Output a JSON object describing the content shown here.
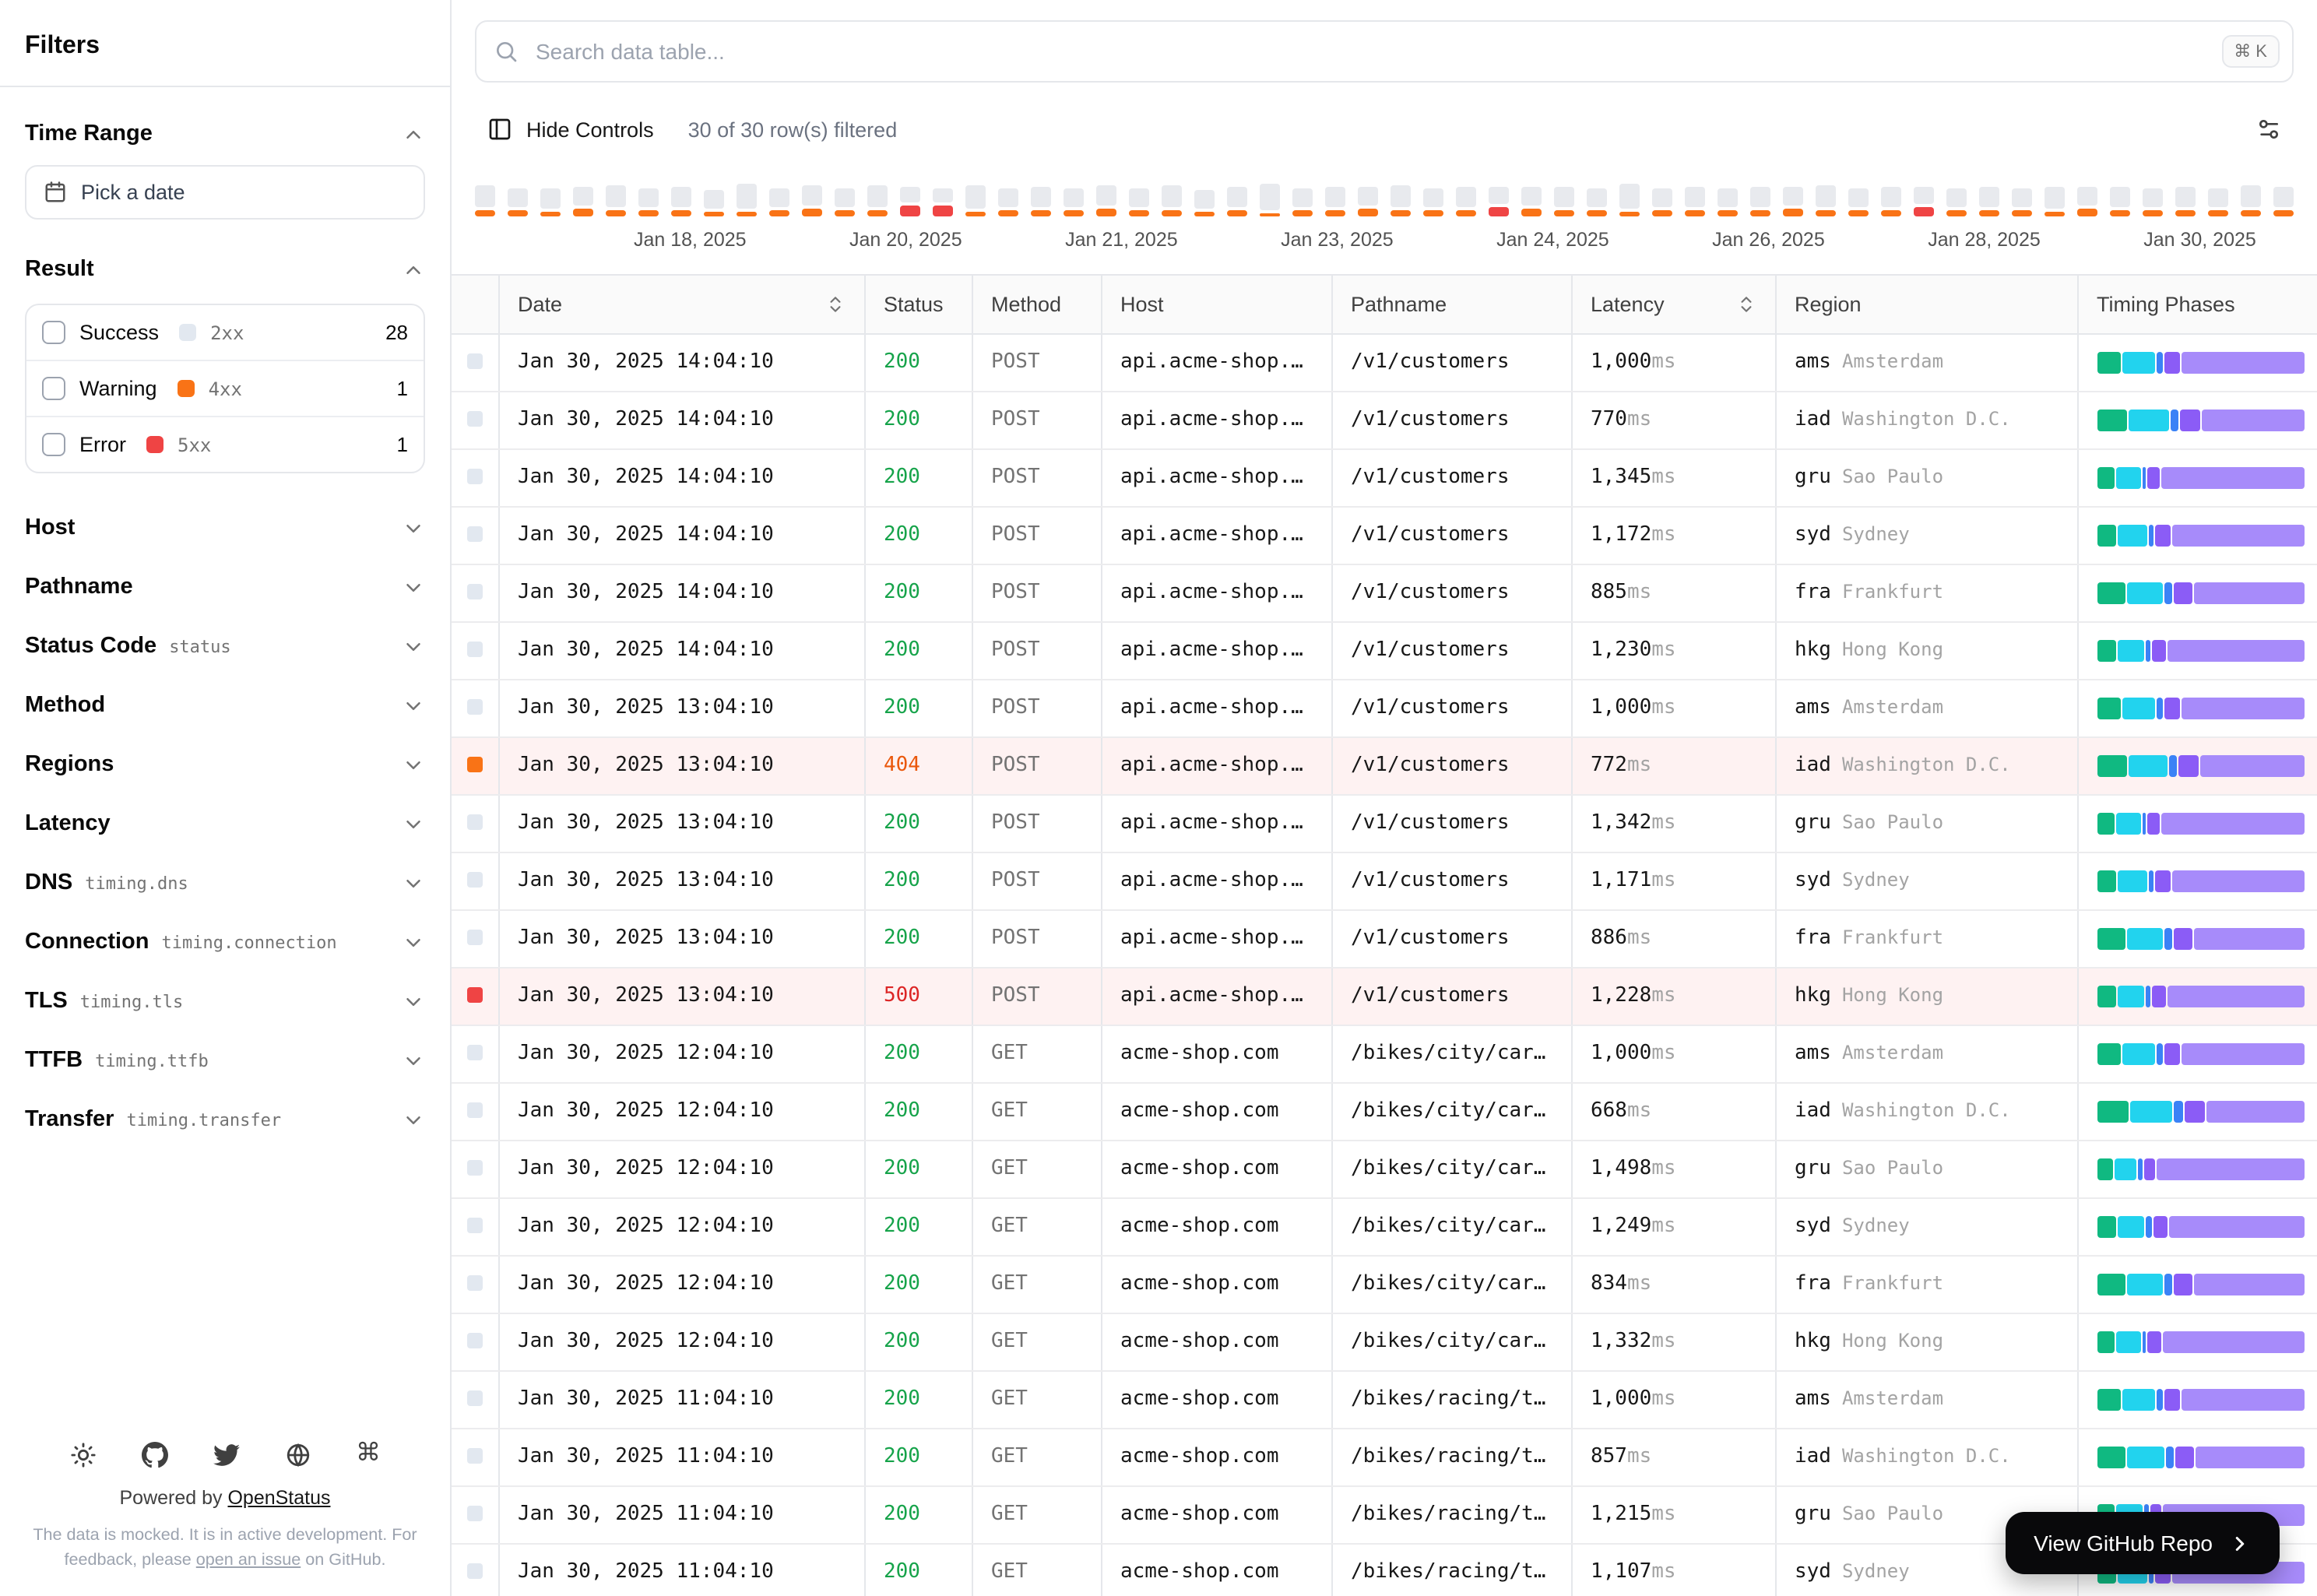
{
  "sidebar": {
    "title": "Filters",
    "time_range": {
      "label": "Time Range",
      "picker": "Pick a date"
    },
    "result": {
      "label": "Result",
      "options": [
        {
          "label": "Success",
          "code": "2xx",
          "count": "28",
          "color": "#e2e8f0"
        },
        {
          "label": "Warning",
          "code": "4xx",
          "count": "1",
          "color": "#f97316"
        },
        {
          "label": "Error",
          "code": "5xx",
          "count": "1",
          "color": "#ef4444"
        }
      ]
    },
    "sections": [
      {
        "label": "Host",
        "tag": ""
      },
      {
        "label": "Pathname",
        "tag": ""
      },
      {
        "label": "Status Code",
        "tag": "status"
      },
      {
        "label": "Method",
        "tag": ""
      },
      {
        "label": "Regions",
        "tag": ""
      },
      {
        "label": "Latency",
        "tag": ""
      },
      {
        "label": "DNS",
        "tag": "timing.dns"
      },
      {
        "label": "Connection",
        "tag": "timing.connection"
      },
      {
        "label": "TLS",
        "tag": "timing.tls"
      },
      {
        "label": "TTFB",
        "tag": "timing.ttfb"
      },
      {
        "label": "Transfer",
        "tag": "timing.transfer"
      }
    ],
    "footer": {
      "powered_prefix": "Powered by ",
      "brand": "OpenStatus",
      "note_prefix": "The data is mocked. It is in active development. For feedback, please ",
      "note_link": "open an issue",
      "note_suffix": " on GitHub."
    }
  },
  "toolbar": {
    "search_placeholder": "Search data table...",
    "kbd": "⌘ K",
    "hide_controls": "Hide Controls",
    "filter_status": "30 of 30 row(s) filtered"
  },
  "timeline": {
    "labels": [
      "Jan 18, 2025",
      "Jan 20, 2025",
      "Jan 21, 2025",
      "Jan 23, 2025",
      "Jan 24, 2025",
      "Jan 26, 2025",
      "Jan 28, 2025",
      "Jan 30, 2025"
    ],
    "bars": [
      [
        14,
        4,
        0
      ],
      [
        12,
        4,
        0
      ],
      [
        13,
        3,
        0
      ],
      [
        12,
        5,
        0
      ],
      [
        14,
        4,
        0
      ],
      [
        12,
        4,
        0
      ],
      [
        13,
        4,
        0
      ],
      [
        12,
        3,
        0
      ],
      [
        16,
        3,
        0
      ],
      [
        12,
        4,
        0
      ],
      [
        13,
        5,
        0
      ],
      [
        12,
        4,
        0
      ],
      [
        14,
        4,
        0
      ],
      [
        10,
        7,
        1
      ],
      [
        9,
        7,
        1
      ],
      [
        15,
        3,
        0
      ],
      [
        12,
        4,
        0
      ],
      [
        13,
        4,
        0
      ],
      [
        12,
        4,
        0
      ],
      [
        13,
        5,
        0
      ],
      [
        12,
        4,
        0
      ],
      [
        14,
        4,
        0
      ],
      [
        12,
        3,
        0
      ],
      [
        13,
        4,
        0
      ],
      [
        17,
        2,
        0
      ],
      [
        12,
        4,
        0
      ],
      [
        13,
        4,
        0
      ],
      [
        12,
        5,
        0
      ],
      [
        14,
        4,
        0
      ],
      [
        12,
        4,
        0
      ],
      [
        13,
        4,
        0
      ],
      [
        11,
        6,
        1
      ],
      [
        12,
        5,
        0
      ],
      [
        13,
        4,
        0
      ],
      [
        12,
        4,
        0
      ],
      [
        16,
        3,
        0
      ],
      [
        12,
        4,
        0
      ],
      [
        13,
        4,
        0
      ],
      [
        12,
        4,
        0
      ],
      [
        13,
        4,
        0
      ],
      [
        12,
        5,
        0
      ],
      [
        14,
        4,
        0
      ],
      [
        12,
        4,
        0
      ],
      [
        13,
        4,
        0
      ],
      [
        11,
        6,
        1
      ],
      [
        12,
        4,
        0
      ],
      [
        13,
        4,
        0
      ],
      [
        12,
        4,
        0
      ],
      [
        14,
        3,
        0
      ],
      [
        12,
        5,
        0
      ],
      [
        13,
        4,
        0
      ],
      [
        12,
        4,
        0
      ],
      [
        13,
        4,
        0
      ],
      [
        12,
        4,
        0
      ],
      [
        14,
        4,
        0
      ],
      [
        13,
        4,
        0
      ]
    ]
  },
  "colors": {
    "warning": "#f97316",
    "error": "#ef4444",
    "status": {
      "success": "#16a34a",
      "warning": "#ea580c",
      "error": "#dc2626"
    },
    "indicator": {
      "success": "#e2e8f0",
      "warning": "#f97316",
      "error": "#ef4444"
    }
  },
  "timing_colors": [
    "#10b981",
    "#22d3ee",
    "#3b82f6",
    "#8b5cf6",
    "#a78bfa"
  ],
  "table": {
    "ms_unit": "ms",
    "columns": [
      {
        "label": "Date",
        "sortable": true
      },
      {
        "label": "Status",
        "sortable": false
      },
      {
        "label": "Method",
        "sortable": false
      },
      {
        "label": "Host",
        "sortable": false
      },
      {
        "label": "Pathname",
        "sortable": false
      },
      {
        "label": "Latency",
        "sortable": true
      },
      {
        "label": "Region",
        "sortable": false
      },
      {
        "label": "Timing Phases",
        "sortable": false
      }
    ],
    "rows": [
      {
        "date": "Jan 30, 2025 14:04:10",
        "status": "200",
        "level": "success",
        "method": "POST",
        "host": "api.acme-shop.…",
        "path": "/v1/customers",
        "latency": "1,000",
        "region": "ams",
        "city": "Amsterdam",
        "timing": [
          12,
          16,
          3,
          8,
          61
        ]
      },
      {
        "date": "Jan 30, 2025 14:04:10",
        "status": "200",
        "level": "success",
        "method": "POST",
        "host": "api.acme-shop.…",
        "path": "/v1/customers",
        "latency": "770",
        "region": "iad",
        "city": "Washington D.C.",
        "timing": [
          15,
          20,
          4,
          10,
          51
        ]
      },
      {
        "date": "Jan 30, 2025 14:04:10",
        "status": "200",
        "level": "success",
        "method": "POST",
        "host": "api.acme-shop.…",
        "path": "/v1/customers",
        "latency": "1,345",
        "region": "gru",
        "city": "Sao Paulo",
        "timing": [
          9,
          12,
          2,
          6,
          71
        ]
      },
      {
        "date": "Jan 30, 2025 14:04:10",
        "status": "200",
        "level": "success",
        "method": "POST",
        "host": "api.acme-shop.…",
        "path": "/v1/customers",
        "latency": "1,172",
        "region": "syd",
        "city": "Sydney",
        "timing": [
          10,
          14,
          3,
          7,
          66
        ]
      },
      {
        "date": "Jan 30, 2025 14:04:10",
        "status": "200",
        "level": "success",
        "method": "POST",
        "host": "api.acme-shop.…",
        "path": "/v1/customers",
        "latency": "885",
        "region": "fra",
        "city": "Frankfurt",
        "timing": [
          14,
          18,
          4,
          9,
          55
        ]
      },
      {
        "date": "Jan 30, 2025 14:04:10",
        "status": "200",
        "level": "success",
        "method": "POST",
        "host": "api.acme-shop.…",
        "path": "/v1/customers",
        "latency": "1,230",
        "region": "hkg",
        "city": "Hong Kong",
        "timing": [
          10,
          13,
          2,
          7,
          68
        ]
      },
      {
        "date": "Jan 30, 2025 13:04:10",
        "status": "200",
        "level": "success",
        "method": "POST",
        "host": "api.acme-shop.…",
        "path": "/v1/customers",
        "latency": "1,000",
        "region": "ams",
        "city": "Amsterdam",
        "timing": [
          12,
          16,
          3,
          8,
          61
        ]
      },
      {
        "date": "Jan 30, 2025 13:04:10",
        "status": "404",
        "level": "warning",
        "method": "POST",
        "host": "api.acme-shop.…",
        "path": "/v1/customers",
        "latency": "772",
        "region": "iad",
        "city": "Washington D.C.",
        "timing": [
          15,
          19,
          4,
          10,
          52
        ]
      },
      {
        "date": "Jan 30, 2025 13:04:10",
        "status": "200",
        "level": "success",
        "method": "POST",
        "host": "api.acme-shop.…",
        "path": "/v1/customers",
        "latency": "1,342",
        "region": "gru",
        "city": "Sao Paulo",
        "timing": [
          9,
          12,
          2,
          6,
          71
        ]
      },
      {
        "date": "Jan 30, 2025 13:04:10",
        "status": "200",
        "level": "success",
        "method": "POST",
        "host": "api.acme-shop.…",
        "path": "/v1/customers",
        "latency": "1,171",
        "region": "syd",
        "city": "Sydney",
        "timing": [
          10,
          14,
          3,
          7,
          66
        ]
      },
      {
        "date": "Jan 30, 2025 13:04:10",
        "status": "200",
        "level": "success",
        "method": "POST",
        "host": "api.acme-shop.…",
        "path": "/v1/customers",
        "latency": "886",
        "region": "fra",
        "city": "Frankfurt",
        "timing": [
          14,
          18,
          4,
          9,
          55
        ]
      },
      {
        "date": "Jan 30, 2025 13:04:10",
        "status": "500",
        "level": "error",
        "method": "POST",
        "host": "api.acme-shop.…",
        "path": "/v1/customers",
        "latency": "1,228",
        "region": "hkg",
        "city": "Hong Kong",
        "timing": [
          10,
          13,
          2,
          7,
          68
        ]
      },
      {
        "date": "Jan 30, 2025 12:04:10",
        "status": "200",
        "level": "success",
        "method": "GET",
        "host": "acme-shop.com",
        "path": "/bikes/city/car…",
        "latency": "1,000",
        "region": "ams",
        "city": "Amsterdam",
        "timing": [
          12,
          16,
          3,
          8,
          61
        ]
      },
      {
        "date": "Jan 30, 2025 12:04:10",
        "status": "200",
        "level": "success",
        "method": "GET",
        "host": "acme-shop.com",
        "path": "/bikes/city/car…",
        "latency": "668",
        "region": "iad",
        "city": "Washington D.C.",
        "timing": [
          16,
          21,
          4,
          10,
          49
        ]
      },
      {
        "date": "Jan 30, 2025 12:04:10",
        "status": "200",
        "level": "success",
        "method": "GET",
        "host": "acme-shop.com",
        "path": "/bikes/city/car…",
        "latency": "1,498",
        "region": "gru",
        "city": "Sao Paulo",
        "timing": [
          8,
          11,
          2,
          6,
          73
        ]
      },
      {
        "date": "Jan 30, 2025 12:04:10",
        "status": "200",
        "level": "success",
        "method": "GET",
        "host": "acme-shop.com",
        "path": "/bikes/city/car…",
        "latency": "1,249",
        "region": "syd",
        "city": "Sydney",
        "timing": [
          10,
          13,
          3,
          7,
          67
        ]
      },
      {
        "date": "Jan 30, 2025 12:04:10",
        "status": "200",
        "level": "success",
        "method": "GET",
        "host": "acme-shop.com",
        "path": "/bikes/city/car…",
        "latency": "834",
        "region": "fra",
        "city": "Frankfurt",
        "timing": [
          14,
          18,
          4,
          9,
          55
        ]
      },
      {
        "date": "Jan 30, 2025 12:04:10",
        "status": "200",
        "level": "success",
        "method": "GET",
        "host": "acme-shop.com",
        "path": "/bikes/city/car…",
        "latency": "1,332",
        "region": "hkg",
        "city": "Hong Kong",
        "timing": [
          9,
          12,
          2,
          7,
          70
        ]
      },
      {
        "date": "Jan 30, 2025 11:04:10",
        "status": "200",
        "level": "success",
        "method": "GET",
        "host": "acme-shop.com",
        "path": "/bikes/racing/t…",
        "latency": "1,000",
        "region": "ams",
        "city": "Amsterdam",
        "timing": [
          12,
          16,
          3,
          8,
          61
        ]
      },
      {
        "date": "Jan 30, 2025 11:04:10",
        "status": "200",
        "level": "success",
        "method": "GET",
        "host": "acme-shop.com",
        "path": "/bikes/racing/t…",
        "latency": "857",
        "region": "iad",
        "city": "Washington D.C.",
        "timing": [
          14,
          19,
          4,
          9,
          54
        ]
      },
      {
        "date": "Jan 30, 2025 11:04:10",
        "status": "200",
        "level": "success",
        "method": "GET",
        "host": "acme-shop.com",
        "path": "/bikes/racing/t…",
        "latency": "1,215",
        "region": "gru",
        "city": "Sao Paulo",
        "timing": [
          9,
          13,
          2,
          6,
          70
        ]
      },
      {
        "date": "Jan 30, 2025 11:04:10",
        "status": "200",
        "level": "success",
        "method": "GET",
        "host": "acme-shop.com",
        "path": "/bikes/racing/t…",
        "latency": "1,107",
        "region": "syd",
        "city": "Sydney",
        "timing": [
          10,
          14,
          3,
          7,
          66
        ]
      }
    ]
  },
  "github_button": {
    "label": "View GitHub Repo"
  }
}
